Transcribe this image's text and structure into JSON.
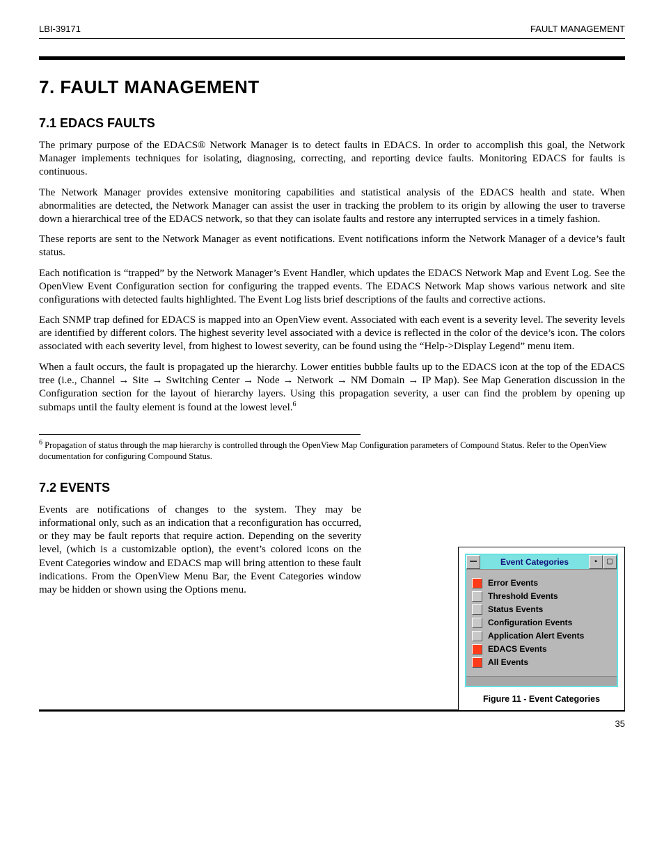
{
  "header": {
    "left": "LBI-39171",
    "right": "FAULT MANAGEMENT"
  },
  "title": "7. FAULT MANAGEMENT",
  "sections": {
    "faults": {
      "heading": "7.1 EDACS FAULTS",
      "p1": "The primary purpose of the EDACS® Network Manager is to detect faults in EDACS. In order to accomplish this goal, the Network Manager implements techniques for isolating, diagnosing, correcting, and reporting device faults. Monitoring EDACS for faults is continuous.",
      "p2": "The Network Manager provides extensive monitoring capabilities and statistical analysis of the EDACS health and state. When abnormalities are detected, the Network Manager can assist the user in tracking the problem to its origin by allowing the user to traverse down a hierarchical tree of the EDACS network, so that they can isolate faults and restore any interrupted services in a timely fashion.",
      "p3": "These reports are sent to the Network Manager as event notifications. Event notifications inform the Network Manager of a device’s fault status.",
      "p4": "Each notification is “trapped” by the Network Manager’s Event Handler, which updates the EDACS Network Map and Event Log. See the OpenView Event Configuration section for configuring the trapped events. The EDACS Network Map shows various network and site configurations with detected faults highlighted. The Event Log lists brief descriptions of the faults and corrective actions.",
      "p5": "Each SNMP trap defined for EDACS is mapped into an OpenView event. Associated with each event is a severity level. The severity levels are identified by different colors. The highest severity level associated with a device is reflected in the color of the device’s icon. The colors associated with each severity level, from highest to lowest severity, can be found using the “Help->Display Legend” menu item.",
      "p6": "When a fault occurs, the fault is propagated up the hierarchy. Lower entities bubble faults up to the EDACS icon at the top of the EDACS tree (i.e., Channel → Site → Switching Center → Node → Network → NM Domain → IP Map). See Map Generation discussion in the Configuration section for the layout of hierarchy layers. Using this propagation severity, a user can find the problem by opening up submaps until the faulty element is found at the lowest level.",
      "fn_marker": "6",
      "fn_text": " Propagation of status through the map hierarchy is controlled through the OpenView Map Configuration parameters of Compound Status. Refer to the OpenView documentation for configuring Compound Status."
    },
    "events": {
      "heading": "7.2 EVENTS",
      "p1": "Events are notifications of changes to the system. They may be informational only, such as an indication that a reconfiguration has occurred, or they may be fault reports that require action. Depending on the severity level, (which is a customizable option), the event’s colored icons on the Event Categories window and EDACS map will bring attention to these fault indications. From the OpenView Menu Bar, the Event Categories window may be hidden or shown using the Options menu.",
      "caption": "Figure 11 - Event Categories"
    }
  },
  "event_categories": {
    "title": "Event Categories",
    "items": [
      {
        "label": "Error Events",
        "active": true
      },
      {
        "label": "Threshold Events",
        "active": false
      },
      {
        "label": "Status Events",
        "active": false
      },
      {
        "label": "Configuration Events",
        "active": false
      },
      {
        "label": "Application Alert Events",
        "active": false
      },
      {
        "label": "EDACS Events",
        "active": true
      },
      {
        "label": "All Events",
        "active": true
      }
    ]
  },
  "footnotes": {
    "rule_marker": "6"
  },
  "footer": {
    "page": "35"
  }
}
